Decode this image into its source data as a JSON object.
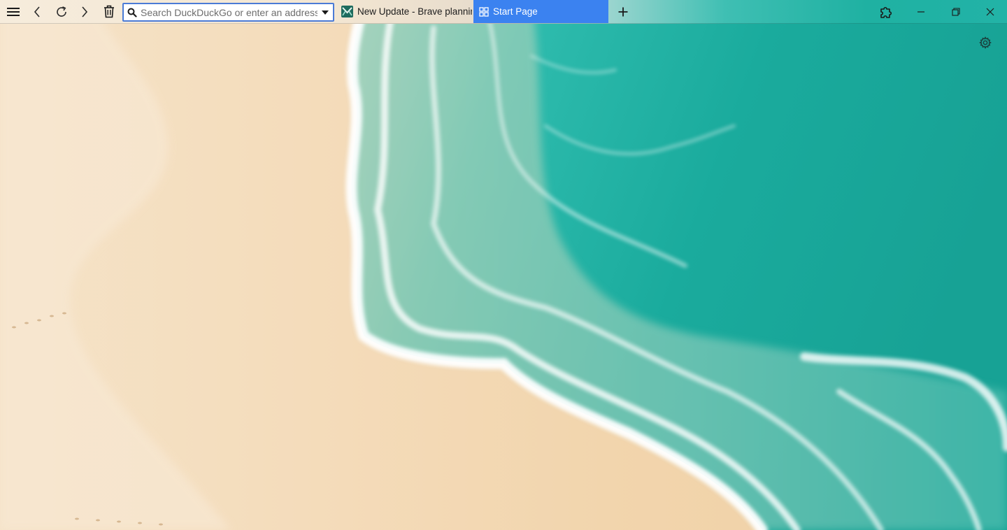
{
  "toolbar": {
    "menu_icon": "hamburger-menu-icon",
    "back_icon": "chevron-left-icon",
    "reload_icon": "reload-icon",
    "forward_icon": "chevron-right-icon",
    "trash_icon": "trash-icon",
    "address_bar": {
      "placeholder": "Search DuckDuckGo or enter an address",
      "value": "",
      "search_icon": "search-icon",
      "dropdown_icon": "caret-down-icon"
    },
    "tabs": [
      {
        "title": "New Update - Brave planning",
        "favicon": "site-favicon",
        "active": false
      },
      {
        "title": "Start Page",
        "favicon": "grid-icon",
        "active": true
      }
    ],
    "new_tab_icon": "plus-icon",
    "extensions_icon": "puzzle-piece-icon",
    "window_controls": [
      "minimize-icon",
      "restore-icon",
      "close-icon"
    ]
  },
  "start_page": {
    "settings_icon": "gear-icon",
    "background": "aerial beach wallpaper"
  },
  "colors": {
    "active_tab": "#3b82f0",
    "address_border": "#4b7bd6",
    "sand": "#f3dcbc",
    "sea": "#1fb1a2"
  }
}
